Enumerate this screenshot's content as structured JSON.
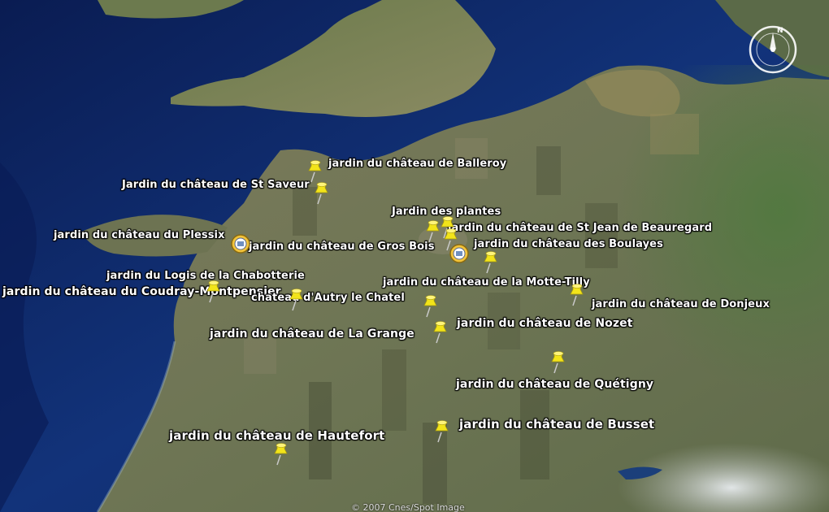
{
  "map": {
    "copyright": "© 2007 Cnes/Spot Image",
    "compass_north": "N",
    "colors": {
      "sea": "#0d2a6b",
      "land": "#6b7256",
      "marker": "#f2e41a",
      "label": "#ffffff"
    },
    "markers": [
      {
        "label": "jardin du château de Balleroy",
        "icon": "yellow-pushpin"
      },
      {
        "label": "Jardin du château de St Saveur",
        "icon": "yellow-pushpin"
      },
      {
        "label": "Jardin des plantes",
        "icon": "yellow-pushpin"
      },
      {
        "label": "jardin du château de St Jean de Beauregard",
        "icon": "yellow-pushpin"
      },
      {
        "label": "jardin du château du Plessix",
        "icon": "photo-marker"
      },
      {
        "label": "jardin du château de Gros Bois",
        "icon": "photo-marker"
      },
      {
        "label": "jardin du château des Boulayes",
        "icon": "yellow-pushpin"
      },
      {
        "label": "jardin du Logis de la Chabotterie",
        "icon": "yellow-pushpin"
      },
      {
        "label": "jardin du château de la Motte-Tilly",
        "icon": "yellow-pushpin"
      },
      {
        "label": "jardin du château du Coudray-Montpensier",
        "icon": "yellow-pushpin"
      },
      {
        "label": "chateau d'Autry le Chatel",
        "icon": "yellow-pushpin"
      },
      {
        "label": "jardin du château de Donjeux",
        "icon": "yellow-pushpin"
      },
      {
        "label": "jardin du château de Nozet",
        "icon": "yellow-pushpin"
      },
      {
        "label": "jardin du château de La Grange",
        "icon": "yellow-pushpin"
      },
      {
        "label": "jardin du château de Quétigny",
        "icon": "yellow-pushpin"
      },
      {
        "label": "jardin du château de Busset",
        "icon": "yellow-pushpin"
      },
      {
        "label": "jardin du château de Hautefort",
        "icon": "yellow-pushpin"
      }
    ]
  }
}
